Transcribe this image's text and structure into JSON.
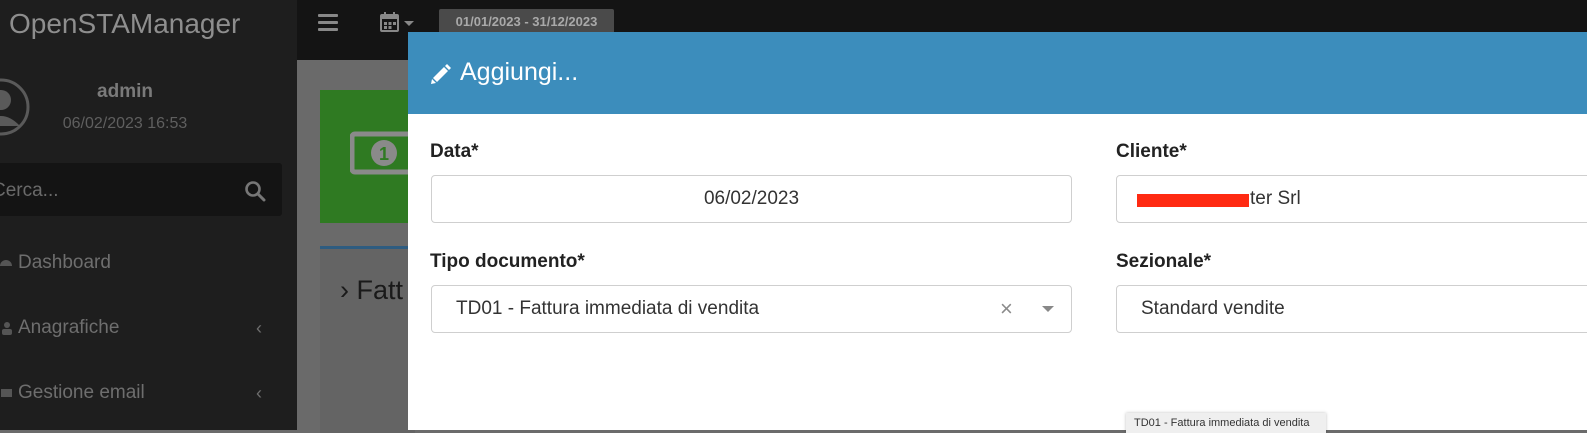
{
  "app": {
    "name": "OpenSTAManager"
  },
  "header": {
    "date_range": "01/01/2023 - 31/12/2023"
  },
  "sidebar": {
    "user": {
      "name": "admin",
      "datetime": "06/02/2023 16:53"
    },
    "search": {
      "placeholder": "Cerca..."
    },
    "items": [
      {
        "label": "Dashboard"
      },
      {
        "label": "Anagrafiche"
      },
      {
        "label": "Gestione email"
      }
    ]
  },
  "page": {
    "panel_title": "Fatt"
  },
  "modal": {
    "title": "Aggiungi...",
    "fields": {
      "data": {
        "label": "Data*",
        "value": "06/02/2023"
      },
      "cliente": {
        "label": "Cliente*",
        "value": "ter Srl"
      },
      "tipo_documento": {
        "label": "Tipo documento*",
        "value": "TD01 - Fattura immediata di vendita"
      },
      "sezionale": {
        "label": "Sezionale*",
        "value": "Standard vendite"
      }
    },
    "tooltip": "TD01 - Fattura immediata di vendita"
  },
  "colors": {
    "modal_header": "#3c8dbc",
    "card_green": "#2f7a22",
    "redaction": "#ff2a12"
  }
}
